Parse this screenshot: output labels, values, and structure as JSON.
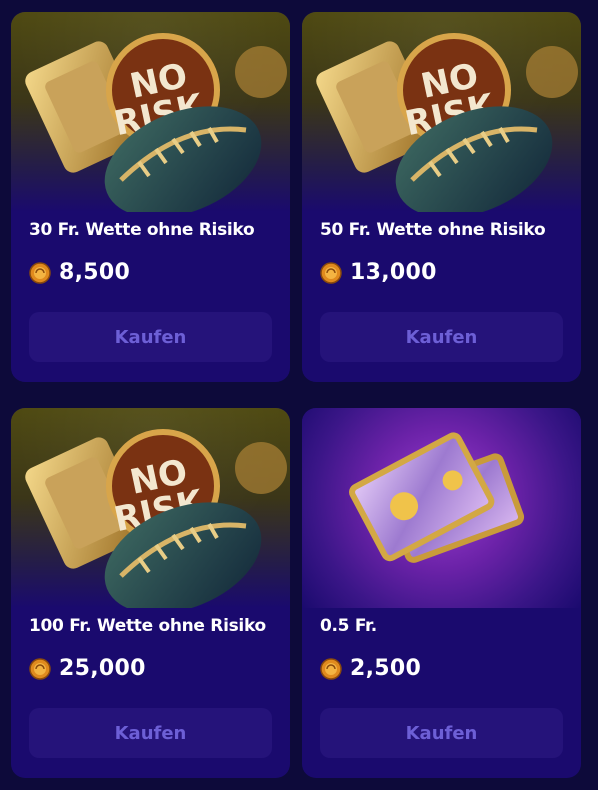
{
  "colors": {
    "page_background": "#0d0a3a",
    "card_background": "#1a0a6e",
    "button_background": "#25137a",
    "button_text": "#6d5fd6",
    "title_text": "#ffffff"
  },
  "art_badge": {
    "line1": "NO",
    "line2": "RISK"
  },
  "cards": [
    {
      "title": "30 Fr. Wette ohne Risiko",
      "price": "8,500",
      "button_label": "Kaufen",
      "art": "no-risk-football",
      "icon": "coin-icon"
    },
    {
      "title": "50 Fr. Wette ohne Risiko",
      "price": "13,000",
      "button_label": "Kaufen",
      "art": "no-risk-football",
      "icon": "coin-icon"
    },
    {
      "title": "100 Fr. Wette ohne Risiko",
      "price": "25,000",
      "button_label": "Kaufen",
      "art": "no-risk-football",
      "icon": "coin-icon"
    },
    {
      "title": "0.5 Fr.",
      "price": "2,500",
      "button_label": "Kaufen",
      "art": "banknotes",
      "icon": "coin-icon"
    }
  ]
}
